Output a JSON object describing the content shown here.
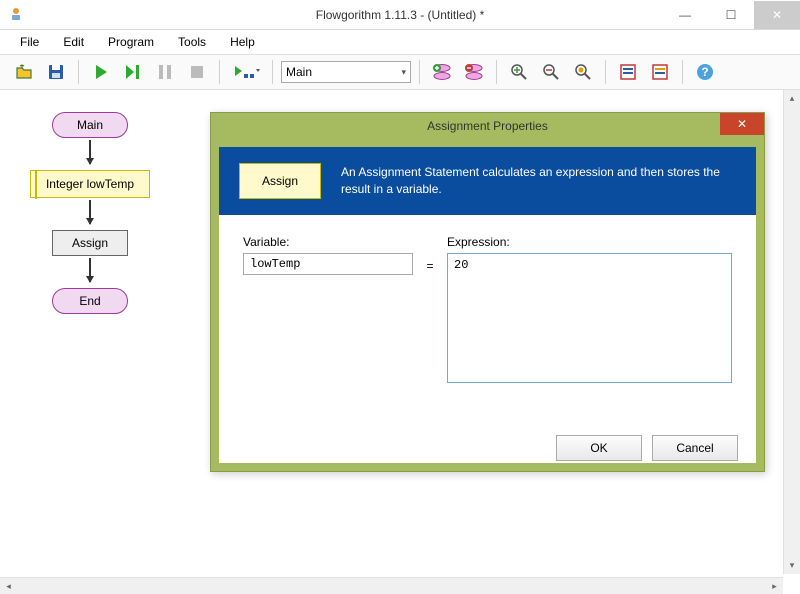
{
  "window": {
    "title": "Flowgorithm 1.11.3 - (Untitled) *",
    "min": "—",
    "max": "☐",
    "close": "✕"
  },
  "menu": {
    "file": "File",
    "edit": "Edit",
    "program": "Program",
    "tools": "Tools",
    "help": "Help"
  },
  "toolbar": {
    "function_selected": "Main",
    "dropdown_caret": "▾"
  },
  "flowchart": {
    "main": "Main",
    "declare": "Integer lowTemp",
    "assign": "Assign",
    "end": "End"
  },
  "dialog": {
    "title": "Assignment Properties",
    "close": "✕",
    "banner_box": "Assign",
    "banner_text": "An Assignment Statement calculates an expression and then stores the result in a variable.",
    "variable_label": "Variable:",
    "expression_label": "Expression:",
    "variable_value": "lowTemp",
    "equals": "=",
    "expression_value": "20",
    "ok": "OK",
    "cancel": "Cancel"
  },
  "scroll": {
    "up": "▴",
    "down": "▾",
    "left": "◂",
    "right": "▸"
  }
}
